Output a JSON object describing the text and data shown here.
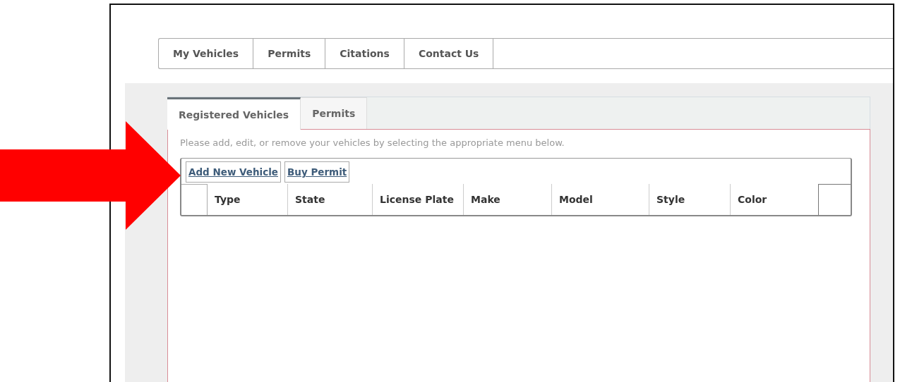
{
  "nav": [
    {
      "label": "My Vehicles"
    },
    {
      "label": "Permits"
    },
    {
      "label": "Citations"
    },
    {
      "label": "Contact Us"
    }
  ],
  "tabs": [
    {
      "label": "Registered Vehicles",
      "selected": true
    },
    {
      "label": "Permits",
      "selected": false
    }
  ],
  "instructions": "Please add, edit, or remove your vehicles by selecting the appropriate menu below.",
  "actions": [
    "Add New Vehicle",
    "Buy Permit"
  ],
  "table": {
    "columns": [
      "Type",
      "State",
      "License Plate",
      "Make",
      "Model",
      "Style",
      "Color"
    ]
  }
}
